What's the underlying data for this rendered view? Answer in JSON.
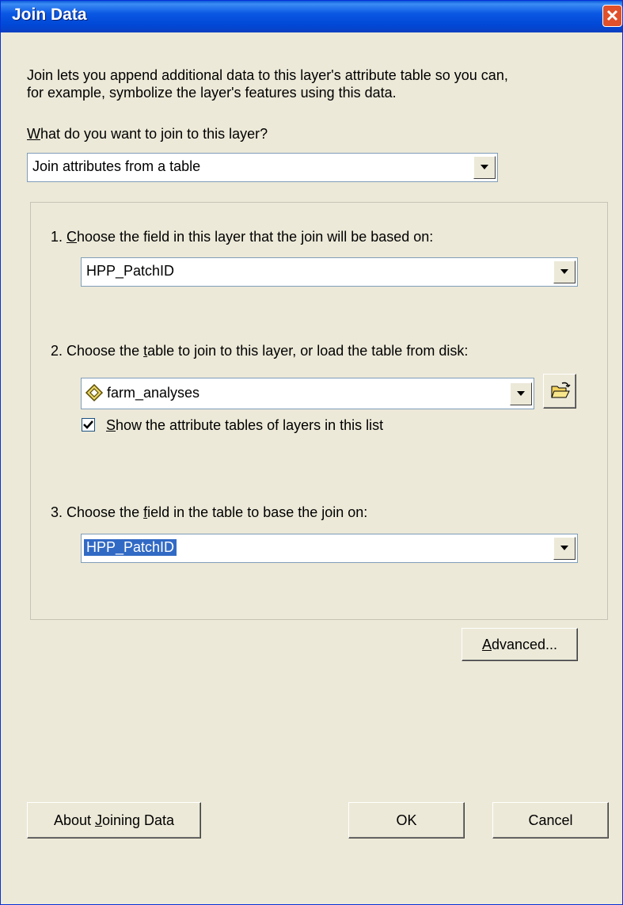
{
  "window": {
    "title": "Join Data"
  },
  "intro": {
    "line1": "Join lets you append additional data to this layer's attribute table so you can,",
    "line2": "for example, symbolize the layer's features using this data."
  },
  "join_question": {
    "prefix": "W",
    "rest": "hat do you want to join to this layer?"
  },
  "join_type": {
    "value": "Join attributes from a table"
  },
  "step1": {
    "pre": "1.  ",
    "accel": "C",
    "rest": "hoose the field in this layer that the join will be based on:",
    "value": "HPP_PatchID"
  },
  "step2": {
    "pre": "2.  Choose the ",
    "accel": "t",
    "rest": "able to join to this layer, or load the table from disk:",
    "value": "farm_analyses"
  },
  "show_tables": {
    "accel": "S",
    "rest": "how the attribute tables of layers in this list",
    "checked": true
  },
  "step3": {
    "pre": "3.  Choose the ",
    "accel": "f",
    "rest": "ield in the table to base the join on:",
    "value": "HPP_PatchID"
  },
  "buttons": {
    "advanced": {
      "accel": "A",
      "rest": "dvanced..."
    },
    "about": {
      "pre": "About ",
      "accel": "J",
      "rest": "oining Data"
    },
    "ok": "OK",
    "cancel": "Cancel"
  },
  "colors": {
    "titlebar": "#0a58e3",
    "dialog_bg": "#ece9d8",
    "selection": "#316ac5"
  }
}
